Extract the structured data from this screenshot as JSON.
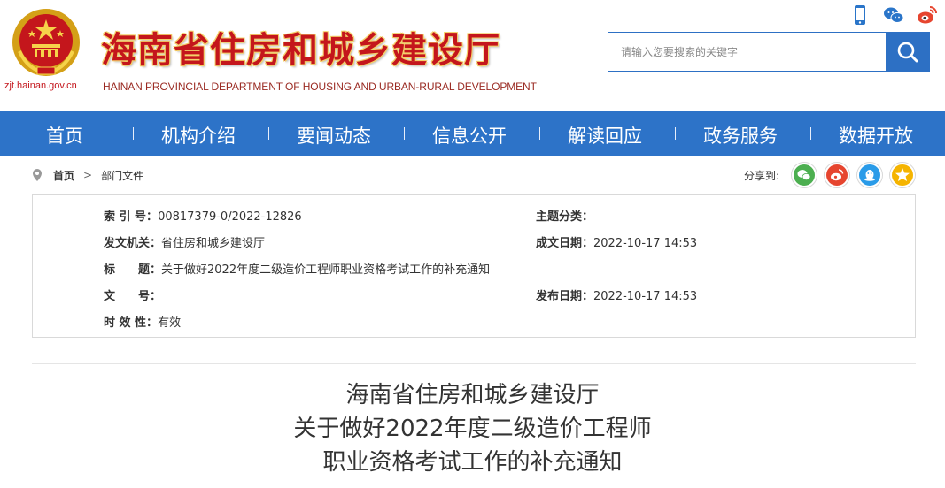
{
  "header": {
    "site_title": "海南省住房和城乡建设厅",
    "site_subtitle": "HAINAN PROVINCIAL DEPARTMENT OF HOUSING AND URBAN-RURAL DEVELOPMENT",
    "domain": "zjt.hainan.gov.cn",
    "search_placeholder": "请输入您要搜索的关键字"
  },
  "nav": {
    "items": [
      "首页",
      "机构介绍",
      "要闻动态",
      "信息公开",
      "解读回应",
      "政务服务",
      "数据开放"
    ]
  },
  "breadcrumb": {
    "home": "首页",
    "separator": ">",
    "current": "部门文件"
  },
  "share": {
    "label": "分享到:"
  },
  "info": {
    "index_label": "索 引 号：",
    "index_value": "00817379-0/2022-12826",
    "topic_label": "主题分类：",
    "topic_value": "",
    "issuer_label": "发文机关：",
    "issuer_value": "省住房和城乡建设厅",
    "created_label": "成文日期：",
    "created_value": "2022-10-17 14:53",
    "title_label": "标　　题：",
    "title_value": "关于做好2022年度二级造价工程师职业资格考试工作的补充通知",
    "docno_label": "文　　号：",
    "docno_value": "",
    "published_label": "发布日期：",
    "published_value": "2022-10-17 14:53",
    "validity_label": "时 效 性：",
    "validity_value": "有效"
  },
  "document": {
    "title_lines": [
      "海南省住房和城乡建设厅",
      "关于做好2022年度二级造价工程师",
      "职业资格考试工作的补充通知"
    ]
  },
  "colors": {
    "brand_red": "#c4161c",
    "nav_blue": "#2d73c8",
    "search_blue": "#2d70c4",
    "wechat_green": "#4caf50",
    "weibo_red": "#e6452f",
    "qq_blue": "#2a9be8",
    "qzone_yellow": "#f5b400"
  }
}
